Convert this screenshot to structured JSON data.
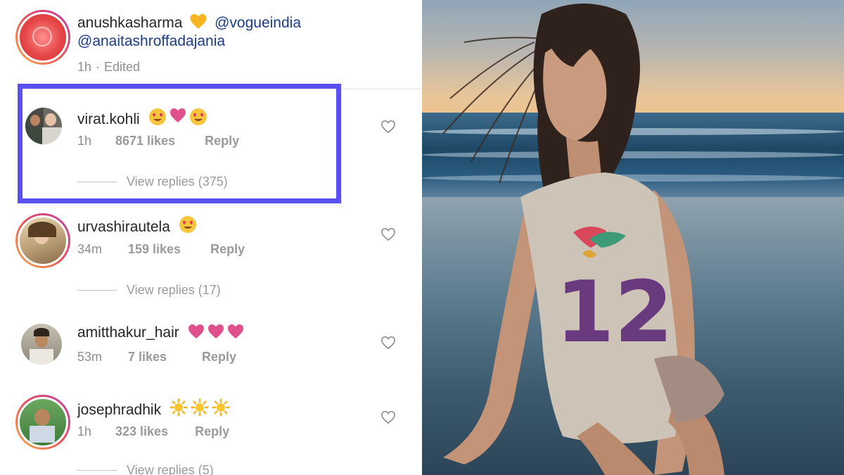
{
  "post": {
    "author": "anushkasharma",
    "mentions": [
      "@vogueindia",
      "@anaitashroffadajania"
    ],
    "time": "1h",
    "separator": "·",
    "edited": "Edited"
  },
  "comments": [
    {
      "username": "virat.kohli",
      "emojis": [
        "smiling-face-with-heart-eyes",
        "pink-heart",
        "smiling-face-with-heart-eyes"
      ],
      "time": "1h",
      "likes": "8671 likes",
      "reply": "Reply",
      "view_replies": "View replies (375)"
    },
    {
      "username": "urvashirautela",
      "emojis": [
        "smiling-face-with-heart-eyes"
      ],
      "time": "34m",
      "likes": "159 likes",
      "reply": "Reply",
      "view_replies": "View replies (17)"
    },
    {
      "username": "amitthakur_hair",
      "emojis": [
        "pink-heart",
        "pink-heart",
        "pink-heart"
      ],
      "time": "53m",
      "likes": "7 likes",
      "reply": "Reply"
    },
    {
      "username": "josephradhik",
      "emojis": [
        "sun",
        "sun",
        "sun"
      ],
      "time": "1h",
      "likes": "323 likes",
      "reply": "Reply",
      "view_replies": "View replies (5)"
    }
  ],
  "colors": {
    "highlight_box": "#5a50f2",
    "meta_text": "#9a9a9a",
    "story_ring": "#ea4f5a",
    "yellow_heart": "#f5b521",
    "pink_heart": "#e0508c"
  },
  "photo": {
    "jersey_number": "12"
  }
}
